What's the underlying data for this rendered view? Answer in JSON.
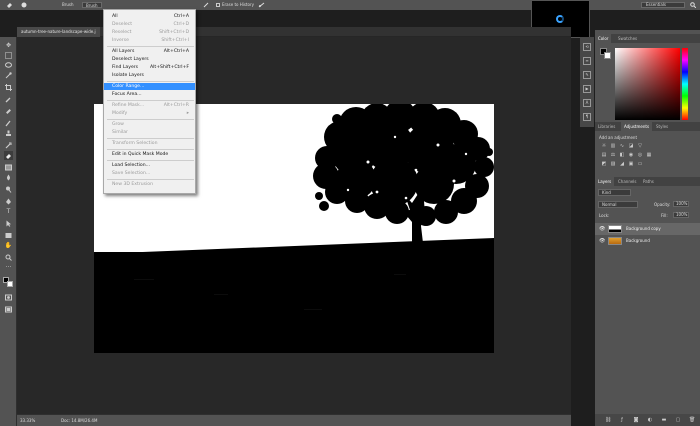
{
  "options_bar": {
    "mode_label": "Brush",
    "preset_label": "Brush",
    "erase_history_label": "Erase to History",
    "workspace": "Essentials"
  },
  "document": {
    "tab_title": "autumn-tree-nature-landscape-wide.j",
    "zoom": "33.33%",
    "doc_info": "Doc: 14.8M/26.4M"
  },
  "menu": {
    "items": [
      {
        "label": "All",
        "shortcut": "Ctrl+A",
        "disabled": false
      },
      {
        "label": "Deselect",
        "shortcut": "Ctrl+D",
        "disabled": true
      },
      {
        "label": "Reselect",
        "shortcut": "Shift+Ctrl+D",
        "disabled": true
      },
      {
        "label": "Inverse",
        "shortcut": "Shift+Ctrl+I",
        "disabled": true
      },
      {
        "label": "All Layers",
        "shortcut": "Alt+Ctrl+A",
        "disabled": false
      },
      {
        "label": "Deselect Layers",
        "shortcut": "",
        "disabled": false
      },
      {
        "label": "Find Layers",
        "shortcut": "Alt+Shift+Ctrl+F",
        "disabled": false
      },
      {
        "label": "Isolate Layers",
        "shortcut": "",
        "disabled": false
      },
      {
        "label": "Color Range...",
        "shortcut": "",
        "disabled": false,
        "highlighted": true
      },
      {
        "label": "Focus Area...",
        "shortcut": "",
        "disabled": false
      },
      {
        "label": "Refine Mask...",
        "shortcut": "Alt+Ctrl+R",
        "disabled": true
      },
      {
        "label": "Modify",
        "shortcut": "",
        "disabled": true,
        "submenu": true
      },
      {
        "label": "Grow",
        "shortcut": "",
        "disabled": true
      },
      {
        "label": "Similar",
        "shortcut": "",
        "disabled": true
      },
      {
        "label": "Transform Selection",
        "shortcut": "",
        "disabled": true
      },
      {
        "label": "Edit in Quick Mask Mode",
        "shortcut": "",
        "disabled": false
      },
      {
        "label": "Load Selection...",
        "shortcut": "",
        "disabled": false
      },
      {
        "label": "Save Selection...",
        "shortcut": "",
        "disabled": true
      },
      {
        "label": "New 3D Extrusion",
        "shortcut": "",
        "disabled": true
      }
    ]
  },
  "panels": {
    "color_tabs": [
      "Color",
      "Swatches"
    ],
    "adj_tabs": [
      "Libraries",
      "Adjustments",
      "Styles"
    ],
    "adj_title": "Add an adjustment",
    "layer_tabs": [
      "Layers",
      "Channels",
      "Paths"
    ],
    "kind_label": "Kind",
    "blend_mode": "Normal",
    "opacity_label": "Opacity:",
    "opacity_value": "100%",
    "lock_label": "Lock:",
    "fill_label": "Fill:",
    "fill_value": "100%",
    "layers": [
      {
        "name": "Background copy"
      },
      {
        "name": "Background"
      }
    ]
  },
  "colors": {
    "menu_highlight": "#3390ff",
    "panel_bg": "#535353",
    "canvas_bg": "#282828"
  }
}
